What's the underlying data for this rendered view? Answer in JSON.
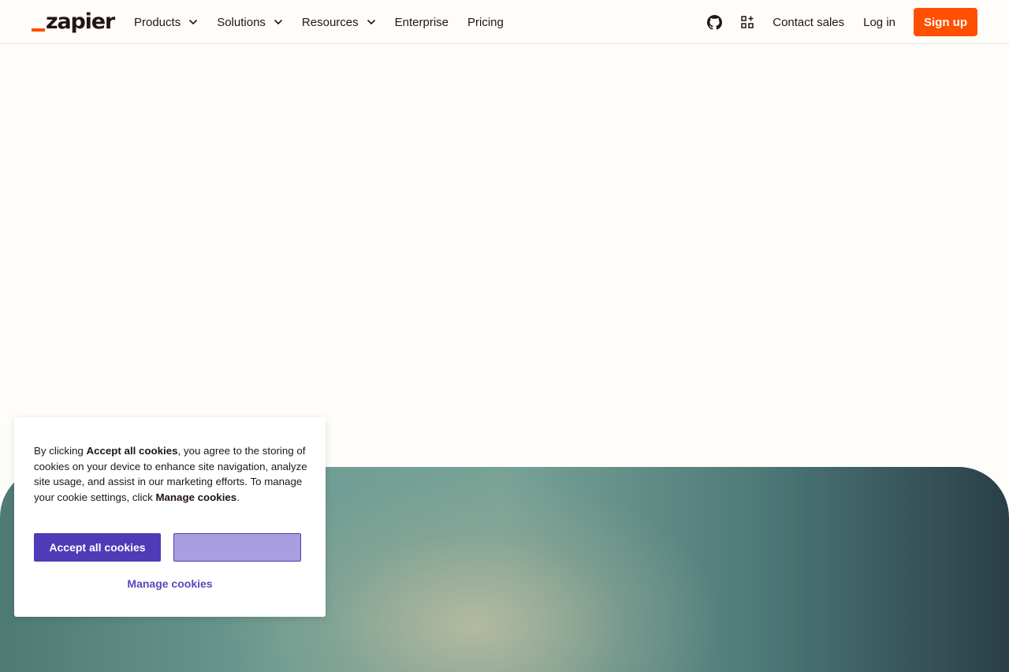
{
  "header": {
    "logo_text": "zapier",
    "nav": [
      {
        "label": "Products",
        "dropdown": true
      },
      {
        "label": "Solutions",
        "dropdown": true
      },
      {
        "label": "Resources",
        "dropdown": true
      },
      {
        "label": "Enterprise",
        "dropdown": false
      },
      {
        "label": "Pricing",
        "dropdown": false
      }
    ],
    "icons": [
      "github-icon",
      "app-grid-plus-icon"
    ],
    "contact_sales": "Contact sales",
    "log_in": "Log in",
    "sign_up": "Sign up"
  },
  "cookie_banner": {
    "text_1": "By clicking ",
    "bold_1": "Accept all cookies",
    "text_2": ", you agree to the storing of cookies on your device to enhance site navigation, analyze site usage, and assist in our marketing efforts. To manage your cookie settings, click ",
    "bold_2": "Manage cookies",
    "text_3": ".",
    "accept_label": "Accept all cookies",
    "manage_label": "Manage cookies"
  },
  "colors": {
    "brand_orange": "#ff4f00",
    "accept_purple": "#4f3ab7",
    "page_background": "#fffdf9"
  }
}
